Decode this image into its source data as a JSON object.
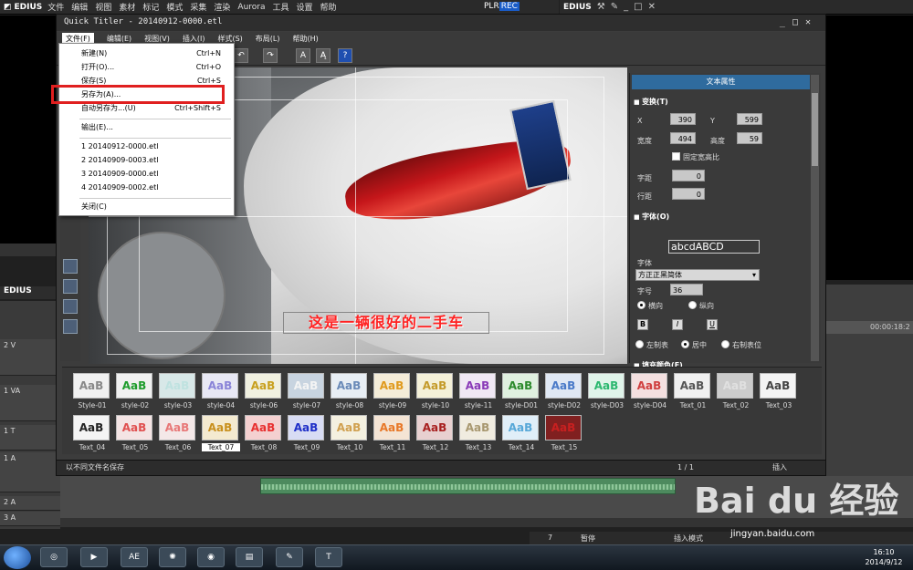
{
  "edius_bar": {
    "logo": "EDIUS",
    "menu": [
      "文件",
      "编辑",
      "视图",
      "素材",
      "标记",
      "模式",
      "采集",
      "渲染",
      "Aurora",
      "工具",
      "设置",
      "帮助"
    ],
    "plr": "PLR",
    "rec": "REC"
  },
  "rec_bar": {
    "logo": "EDIUS"
  },
  "timeline": {
    "logo": "EDIUS",
    "tracks": [
      "2 V",
      "1 VA",
      "1 T",
      "1 A",
      "2 A",
      "3 A"
    ],
    "ruler": "00:00:18:2",
    "status_pause": "暂停",
    "status_mode": "插入模式",
    "status_num": "7"
  },
  "qt": {
    "title": "Quick Titler - 20140912-0000.etl",
    "menu": [
      "文件(F)",
      "编辑(E)",
      "视图(V)",
      "插入(I)",
      "样式(S)",
      "布局(L)",
      "帮助(H)"
    ],
    "caption": "这是一辆很好的二手车",
    "status": "以不同文件名保存",
    "page": "1 / 1",
    "insert": "插入"
  },
  "file_menu": {
    "items": [
      {
        "label": "新建(N)",
        "shortcut": "Ctrl+N"
      },
      {
        "label": "打开(O)...",
        "shortcut": "Ctrl+O"
      },
      {
        "label": "保存(S)",
        "shortcut": "Ctrl+S"
      },
      {
        "label": "另存为(A)...",
        "shortcut": ""
      },
      {
        "label": "自动另存为...(U)",
        "shortcut": "Ctrl+Shift+S"
      },
      {
        "label": "输出(E)...",
        "shortcut": ""
      },
      {
        "label": "1 20140912-0000.etl",
        "shortcut": ""
      },
      {
        "label": "2 20140909-0003.etl",
        "shortcut": ""
      },
      {
        "label": "3 20140909-0000.etl",
        "shortcut": ""
      },
      {
        "label": "4 20140909-0002.etl",
        "shortcut": ""
      },
      {
        "label": "关闭(C)",
        "shortcut": ""
      }
    ]
  },
  "props": {
    "header": "文本属性",
    "transform": "变换(T)",
    "x_label": "X",
    "x_val": "390",
    "y_label": "Y",
    "y_val": "599",
    "w_label": "宽度",
    "w_val": "494",
    "h_label": "高度",
    "h_val": "59",
    "keep_ratio": "固定宽高比",
    "spacing_label": "字距",
    "spacing_val": "0",
    "line_label": "行距",
    "line_val": "0",
    "font_section": "字体(O)",
    "font_preview": "abcdABCD",
    "font_label": "字体",
    "font_name": "方正正黑简体",
    "size_label": "字号",
    "size_val": "36",
    "horizontal": "横向",
    "vertical": "纵向",
    "bold": "B",
    "italic": "I",
    "underline": "U",
    "align_left": "左制表",
    "align_center": "居中",
    "align_right": "右制表位",
    "fill_section": "填充颜色(F)",
    "fill_color": "#e02a1e"
  },
  "styles": [
    {
      "name": "Style-01",
      "color": "#888888",
      "bg": "#f0f0f0"
    },
    {
      "name": "style-02",
      "color": "#1e9c2c",
      "bg": "#f0f0f0"
    },
    {
      "name": "style-03",
      "color": "#bfe2e0",
      "bg": "#d8e8e8"
    },
    {
      "name": "style-04",
      "color": "#8a84d8",
      "bg": "#e8e8f4"
    },
    {
      "name": "style-06",
      "color": "#c8a01e",
      "bg": "#f0f0e0"
    },
    {
      "name": "style-07",
      "color": "#f4f4f4",
      "bg": "#c8d4e0"
    },
    {
      "name": "style-08",
      "color": "#6a8ab8",
      "bg": "#e8eef4"
    },
    {
      "name": "style-09",
      "color": "#e09a1e",
      "bg": "#f4ecd8"
    },
    {
      "name": "style-10",
      "color": "#c49a2a",
      "bg": "#f4f0d8"
    },
    {
      "name": "style-11",
      "color": "#8a3ab8",
      "bg": "#f0e8f4"
    },
    {
      "name": "style-D01",
      "color": "#2c8a2c",
      "bg": "#e0f0e0"
    },
    {
      "name": "style-D02",
      "color": "#4a7ac8",
      "bg": "#e0e8f4"
    },
    {
      "name": "style-D03",
      "color": "#2cb870",
      "bg": "#e0f4ea"
    },
    {
      "name": "style-D04",
      "color": "#d04040",
      "bg": "#f4e0e0"
    },
    {
      "name": "Text_01",
      "color": "#555555",
      "bg": "#f0f0f0"
    },
    {
      "name": "Text_02",
      "color": "#e0e0e0",
      "bg": "#cccccc"
    },
    {
      "name": "Text_03",
      "color": "#444444",
      "bg": "#f4f4f4"
    },
    {
      "name": "Text_04",
      "color": "#222222",
      "bg": "#f4f4f4"
    },
    {
      "name": "Text_05",
      "color": "#e05050",
      "bg": "#f4e4e4"
    },
    {
      "name": "Text_06",
      "color": "#e87878",
      "bg": "#f4e8e8"
    },
    {
      "name": "Text_07",
      "color": "#c8901e",
      "bg": "#f4ead0"
    },
    {
      "name": "Text_08",
      "color": "#e83030",
      "bg": "#f4d0d0"
    },
    {
      "name": "Text_09",
      "color": "#2030c8",
      "bg": "#d8dcf4"
    },
    {
      "name": "Text_10",
      "color": "#d0a050",
      "bg": "#f4f0e0"
    },
    {
      "name": "Text_11",
      "color": "#e87828",
      "bg": "#f4e4d4"
    },
    {
      "name": "Text_12",
      "color": "#a82020",
      "bg": "#e8d0d0"
    },
    {
      "name": "Text_13",
      "color": "#a89870",
      "bg": "#f0ece0"
    },
    {
      "name": "Text_14",
      "color": "#58a8d8",
      "bg": "#e0eef8"
    },
    {
      "name": "Text_15",
      "color": "#c82020",
      "bg": "#802020"
    }
  ],
  "styles_swatch_text": "AaB",
  "selected_style": "Text_07",
  "taskbar": {
    "time": "16:10",
    "date": "2014/9/12",
    "ae": "AE"
  },
  "watermark": "Bai du 经验",
  "watermark_sub": "jingyan.baidu.com"
}
